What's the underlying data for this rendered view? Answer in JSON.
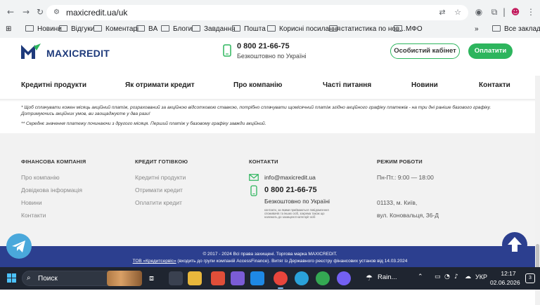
{
  "browser": {
    "url": "maxicredit.ua/uk",
    "bookmarks": [
      "Новини",
      "Відгуки",
      "Коментарі",
      "BA",
      "Блоги",
      "Завдання",
      "Пошта",
      "Корисні посилання",
      "статистика по нов...",
      "МФО"
    ],
    "bookmarks_overflow": "»",
    "all_bookmarks_label": "Все закладки"
  },
  "header": {
    "logo_text": "MAXICREDIT",
    "phone": "0 800 21-66-75",
    "phone_sub": "Безкоштовно по Україні",
    "cabinet_label": "Особистий кабінет",
    "pay_label": "Оплатити"
  },
  "nav": {
    "items": [
      "Кредитні продукти",
      "Як отримати кредит",
      "Про компанію",
      "Часті питання",
      "Новини",
      "Контакти"
    ]
  },
  "notes": {
    "note1": "* Щоб сплачувати кожен місяць акційний платіж, розрахований за акційною відсотковою ставкою, потрібно сплачувати щомісячний платіж згідно акційного графіку платежів - на три дні раніше базового графіку. Дотримуючись акційних умов, ви заощаджуєте у два рази!",
    "note2": "** Середнє значення платежу починаючи з другого місяця. Перший платіж у базовому графіку завжди акційний."
  },
  "footer": {
    "col1": {
      "title": "ФІНАНСОВА КОМПАНІЯ",
      "links": [
        "Про компанію",
        "Довідкова інформація",
        "Новини",
        "Контакти"
      ]
    },
    "col2": {
      "title": "КРЕДИТ ГОТІВКОЮ",
      "links": [
        "Кредитні продукти",
        "Отримати кредит",
        "Оплатити кредит"
      ]
    },
    "col3": {
      "title": "КОНТАКТИ",
      "email": "info@maxicredit.ua",
      "phone": "0 800 21-66-75",
      "phone_sub": "Безкоштовно по Україні",
      "small": "контакти, за якими приймаються повідомлення споживачів та інших осіб, зокрема також що належать до захищеної категорії осіб"
    },
    "col4": {
      "title": "РЕЖИМ РОБОТИ",
      "hours": "Пн-Пт.: 9:00 — 18:00",
      "address1": "01133, м. Київ,",
      "address2": "вул. Коновальця, 36-Д"
    },
    "copyright": "© 2017 - 2024 Всі права захищені. Торгова марка MAXICREDIT.",
    "legal_link": "ТОВ «Кредитсервіс»",
    "legal_rest": " (входить до групи компаній AccessFinance). Витяг із Державного реєстру фінансових установ від 14.03.2024"
  },
  "taskbar": {
    "search_label": "Поиск",
    "weather": "Rain...",
    "language": "УКР",
    "time": "12:17",
    "date": "02.06.2026",
    "notifications": "3"
  },
  "colors": {
    "brand_blue": "#2c3f8f",
    "brand_green": "#2db55d",
    "telegram": "#4aa8db"
  }
}
